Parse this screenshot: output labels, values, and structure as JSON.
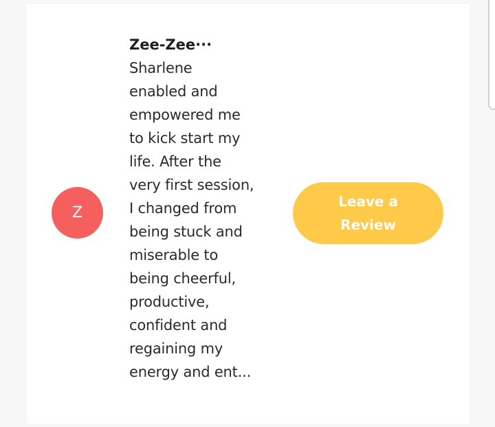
{
  "review_card": {
    "avatar_initial": "Z",
    "reviewer_name": "Zee-Zee···",
    "review_lines": [
      "Sharlene",
      "enabled and",
      "empowered me",
      "to kick start my",
      "life. After the",
      "very first session,",
      "I changed from",
      "being stuck and",
      "miserable to",
      "being cheerful,",
      "productive,",
      "confident and",
      "regaining my",
      "energy and ent..."
    ],
    "button_lines": [
      "Leave a",
      "Review"
    ]
  },
  "colors": {
    "avatar": "#f5605f",
    "button": "#ffc94a",
    "card": "#ffffff",
    "page": "#f7f7f7"
  }
}
